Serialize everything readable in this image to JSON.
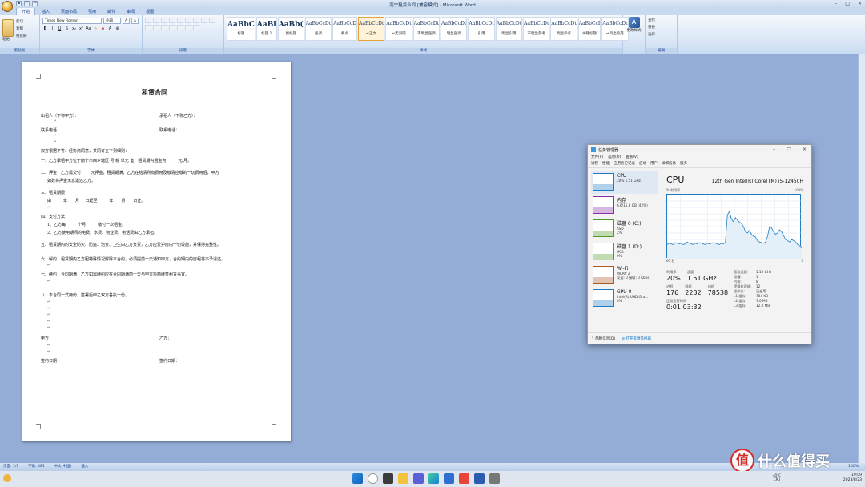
{
  "word": {
    "window_title": "南宁租赁合同 [兼容模式] - Microsoft Word",
    "window_controls": [
      "–",
      "□",
      "×"
    ],
    "qat": [
      "保存",
      "撤销",
      "恢复"
    ],
    "tabs": [
      "开始",
      "插入",
      "页面布局",
      "引用",
      "邮件",
      "审阅",
      "视图"
    ],
    "active_tab": "开始",
    "clipboard": {
      "paste": "粘贴",
      "cut": "剪切",
      "copy": "复制",
      "format_painter": "格式刷",
      "label": "剪贴板"
    },
    "font": {
      "name": "Times New Roman",
      "size": "小四",
      "label": "字体",
      "bold": "B",
      "italic": "I",
      "underline": "U"
    },
    "paragraph_label": "段落",
    "styles_label": "样式",
    "styles": [
      {
        "sample": "AaBbC",
        "name": "标题",
        "big": true
      },
      {
        "sample": "AaBl",
        "name": "标题 1",
        "big": true
      },
      {
        "sample": "AaBb(",
        "name": "副标题",
        "big": true
      },
      {
        "sample": "AaBbCcDt",
        "name": "强调"
      },
      {
        "sample": "AaBbCcD",
        "name": "要点"
      },
      {
        "sample": "AaBbCcDt",
        "name": "↵正文",
        "selected": true
      },
      {
        "sample": "AaBbCcDt",
        "name": "↵无间隔"
      },
      {
        "sample": "AaBbCcDt",
        "name": "不明显强调"
      },
      {
        "sample": "AaBbCcDt",
        "name": "明显强调"
      },
      {
        "sample": "AaBbCcDt",
        "name": "引用"
      },
      {
        "sample": "AaBbCcDt",
        "name": "明显引用"
      },
      {
        "sample": "AaBbCcDt",
        "name": "不明显参考"
      },
      {
        "sample": "AaBbCcDt",
        "name": "明显参考"
      },
      {
        "sample": "AaBbCcI",
        "name": "书籍标题"
      },
      {
        "sample": "AaBbCcDt",
        "name": "↵列出段落"
      }
    ],
    "change_styles": "更改样式",
    "editing": {
      "find": "查找",
      "replace": "替换",
      "select": "选择",
      "label": "编辑"
    },
    "status": {
      "page": "页面: 1/1",
      "words": "字数: 481",
      "lang": "中文(中国)",
      "mode": "插入",
      "zoom": "100%"
    }
  },
  "document": {
    "title": "租赁合同",
    "lines": [
      "出租人（下称甲方）：",
      "承租人（下称乙方）：",
      "联系电话：",
      "联系电话：",
      "双方根据平等、经协商同意，共同订立下列细则：",
      "一、乙方承租甲方位于南宁市西乡塘区   号   栋   单元   室，租赁期内租金为______元/月。",
      "二、押金：乙方需交付_____元押金，租赁期满，乙方在结清所有费用及缴清应缴的一切费用后，甲方",
      "如数将押金无息退还乙方。",
      "三、租赁期限：",
      "由______年____月___日起至______年____月____日止。",
      "四、支付方法：",
      "1、乙方每______个月______缴付一次租金。",
      "2、乙方使用期间的电费、水费、物业费、电话费由乙方承担。",
      "五、租赁期内的安全防火、防盗、治安、卫生由乙方负责，乙方应爱护房内一切设施，并保持完整性。",
      "六、解约：租赁期内乙方因特殊情况解除本合约，必须提前十天通知甲方，合约期内的房租将不予退还。",
      "七、续约：合同期满，乙方如需续约应在合同期满前十天与甲方协商续签租赁事宜。",
      "八、本合同一式两份，签署后甲乙双方各执一份。",
      "甲方：",
      "乙方：",
      "签约日期：",
      "签约日期："
    ]
  },
  "taskmgr": {
    "title": "任务管理器",
    "menu": [
      "文件(F)",
      "选项(O)",
      "查看(V)"
    ],
    "tabs": [
      "进程",
      "性能",
      "应用历史记录",
      "启动",
      "用户",
      "详细信息",
      "服务"
    ],
    "active_tab": "性能",
    "resources": [
      {
        "name": "CPU",
        "sub": "20% 1.51 GHz",
        "color": "#1f7cc4",
        "active": true
      },
      {
        "name": "内存",
        "sub": "6.6/15.8 GB (42%)",
        "color": "#8b2fa8"
      },
      {
        "name": "磁盘 0 (C:)",
        "sub": "SSD",
        "sub2": "2%",
        "color": "#4d9a26"
      },
      {
        "name": "磁盘 1 (D:)",
        "sub": "USB",
        "sub2": "0%",
        "color": "#4d9a26"
      },
      {
        "name": "Wi-Fi",
        "sub": "WLAN 2",
        "sub2": "发送: 0 接收: 0 Kbps",
        "color": "#a85a22"
      },
      {
        "name": "GPU 0",
        "sub": "Intel(R) UHD Gra...",
        "sub2": "0%",
        "color": "#1f7cc4"
      }
    ],
    "cpu_title": "CPU",
    "cpu_model": "12th Gen Intel(R) Core(TM) i5-12450H",
    "graph_label_left": "% 利用率",
    "graph_label_right": "100%",
    "graph_bottom_left": "60 秒",
    "graph_bottom_right": "0",
    "stats": {
      "util_lbl": "利用率",
      "util": "20%",
      "speed_lbl": "速度",
      "speed": "1.51 GHz",
      "proc_lbl": "进程",
      "proc": "176",
      "thread_lbl": "线程",
      "thread": "2232",
      "handle_lbl": "句柄",
      "handle": "78538",
      "uptime_lbl": "正常运行时间",
      "uptime": "0:01:03:32"
    },
    "specs": [
      {
        "k": "基准速度:",
        "v": "1.10 GHz"
      },
      {
        "k": "插槽:",
        "v": "1"
      },
      {
        "k": "内核:",
        "v": "8"
      },
      {
        "k": "逻辑处理器:",
        "v": "12"
      },
      {
        "k": "虚拟化:",
        "v": "已启用"
      },
      {
        "k": "L1 缓存:",
        "v": "704 KB"
      },
      {
        "k": "L2 缓存:",
        "v": "7.0 MB"
      },
      {
        "k": "L3 缓存:",
        "v": "12.0 MB"
      }
    ],
    "cpu_history": [
      22,
      24,
      23,
      22,
      25,
      24,
      23,
      24,
      22,
      23,
      26,
      24,
      23,
      22,
      24,
      23,
      25,
      24,
      23,
      22,
      24,
      23,
      24,
      25,
      24,
      23,
      22,
      24,
      23,
      25,
      68,
      74,
      62,
      58,
      64,
      60,
      57,
      55,
      50,
      42,
      40,
      44,
      38,
      35,
      34,
      28,
      26,
      25,
      24,
      26,
      35,
      50,
      48,
      42,
      38,
      40,
      45,
      42,
      36,
      30,
      28,
      26,
      30,
      28,
      26,
      22,
      20,
      18
    ],
    "footer_less": "简略信息(D)",
    "footer_link": "打开资源监视器"
  },
  "taskbar": {
    "temp": "40°C",
    "temp_sub": "CPU",
    "time": "19:09",
    "date": "2023/8/23"
  },
  "watermark": {
    "text": "什么值得买",
    "sub": "SMYZ.NET"
  }
}
